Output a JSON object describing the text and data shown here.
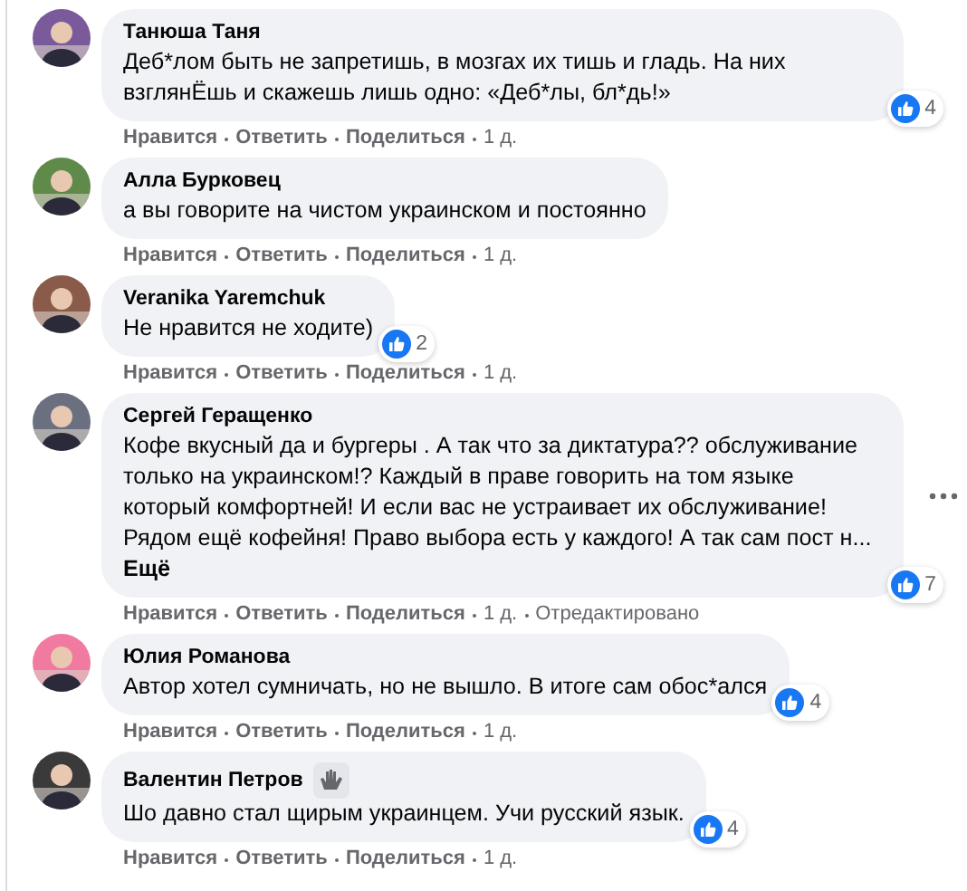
{
  "comments": [
    {
      "author": "Танюша Таня",
      "text": "Деб*лом быть не запретишь, в мозгах их тишь и гладь. На них взглянЁшь и скажешь лишь одно: «Деб*лы, бл*дь!»",
      "reactions": "4",
      "actions": [
        "Нравится",
        "Ответить",
        "Поделиться"
      ],
      "time": "1 д."
    },
    {
      "author": "Алла Бурковец",
      "text": "а вы говорите на чистом украинском и постоянно",
      "actions": [
        "Нравится",
        "Ответить",
        "Поделиться"
      ],
      "time": "1 д."
    },
    {
      "author": "Veranika Yaremchuk",
      "text": "Не нравится не ходите)",
      "reactions": "2",
      "actions": [
        "Нравится",
        "Ответить",
        "Поделиться"
      ],
      "time": "1 д."
    },
    {
      "author": "Сергей Геращенко",
      "text": "Кофе вкусный да и бургеры . А так что за диктатура?? обслуживание только на украинском!? Каждый в праве говорить на том языке который комфортней! И если вас не устраивает их обслуживание! Рядом ещё кофейня! Право выбора есть у каждого! А так сам пост н...",
      "see_more": "Ещё",
      "more_menu": true,
      "reactions": "7",
      "actions": [
        "Нравится",
        "Ответить",
        "Поделиться"
      ],
      "time": "1 д.",
      "edited": "Отредактировано"
    },
    {
      "author": "Юлия Романова",
      "text": "Автор хотел сумничать, но не вышло. В итоге сам обос*ался",
      "reactions": "4",
      "actions": [
        "Нравится",
        "Ответить",
        "Поделиться"
      ],
      "time": "1 д."
    },
    {
      "author": "Валентин Петров",
      "author_badge": true,
      "text": "Шо давно стал щирым украинцем. Учи русский язык.",
      "reactions": "4",
      "actions": [
        "Нравится",
        "Ответить",
        "Поделиться"
      ],
      "time": "1 д."
    }
  ]
}
